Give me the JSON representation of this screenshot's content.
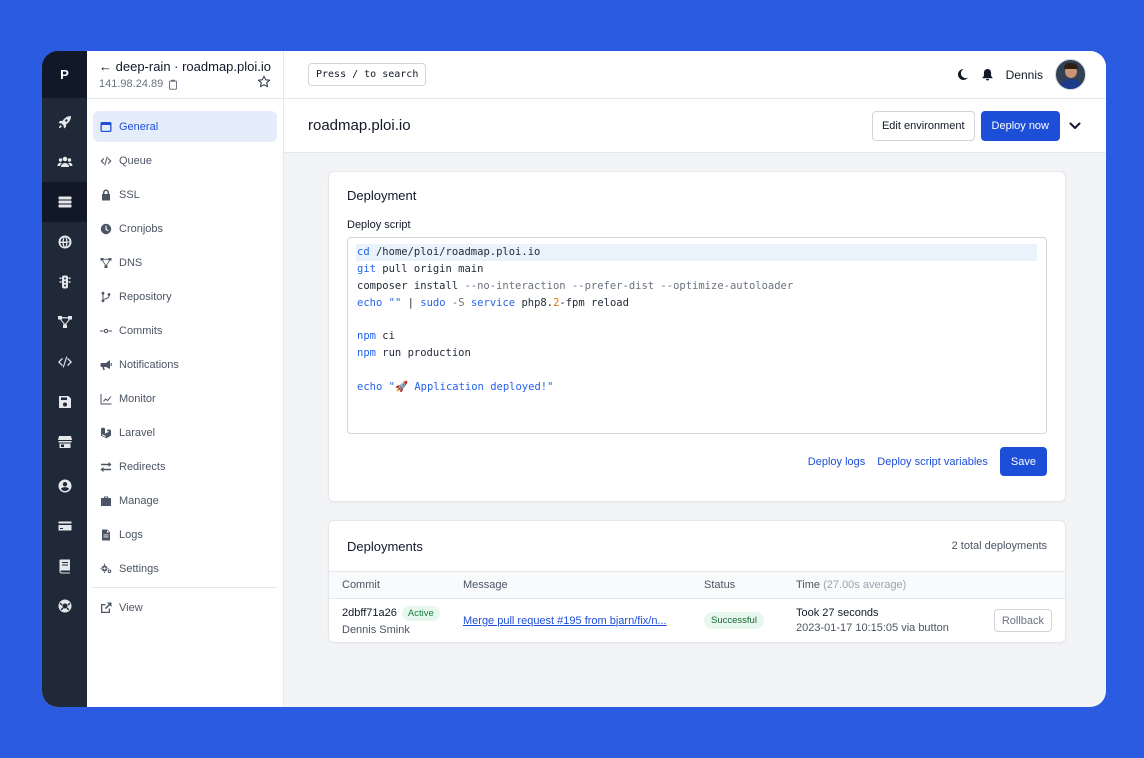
{
  "rail": {
    "logo": "P",
    "items": [
      "rocket-icon",
      "users-icon",
      "server-icon",
      "globe-icon",
      "traffic-light-icon",
      "network-icon",
      "code-icon",
      "save-icon",
      "store-icon",
      "user-circle-icon",
      "credit-card-icon",
      "book-icon",
      "lifebuoy-icon"
    ],
    "active": "server-icon"
  },
  "site": {
    "name": "deep-rain · roadmap.ploi.io",
    "ip": "141.98.24.89"
  },
  "nav": {
    "general": "General",
    "queue": "Queue",
    "ssl": "SSL",
    "cronjobs": "Cronjobs",
    "dns": "DNS",
    "repository": "Repository",
    "commits": "Commits",
    "notifications": "Notifications",
    "monitor": "Monitor",
    "laravel": "Laravel",
    "redirects": "Redirects",
    "manage": "Manage",
    "logs": "Logs",
    "settings": "Settings",
    "view": "View"
  },
  "topbar": {
    "search_hint": "Press / to search",
    "username": "Dennis"
  },
  "header": {
    "title": "roadmap.ploi.io",
    "edit_env": "Edit environment",
    "deploy_now": "Deploy now"
  },
  "deployment": {
    "title": "Deployment",
    "script_label": "Deploy script",
    "deploy_logs": "Deploy logs",
    "script_vars": "Deploy script variables",
    "save": "Save"
  },
  "deployments": {
    "title": "Deployments",
    "total": "2 total deployments",
    "columns": {
      "commit": "Commit",
      "message": "Message",
      "status": "Status",
      "time": "Time",
      "time_avg": "(27.00s average)"
    },
    "rows": [
      {
        "hash": "2dbff71a26",
        "badge": "Active",
        "author": "Dennis Smink",
        "message": "Merge pull request #195 from bjarn/fix/n...",
        "status": "Successful",
        "took": "Took 27 seconds",
        "when": "2023-01-17 10:15:05 via button",
        "rollback": "Rollback"
      }
    ]
  }
}
